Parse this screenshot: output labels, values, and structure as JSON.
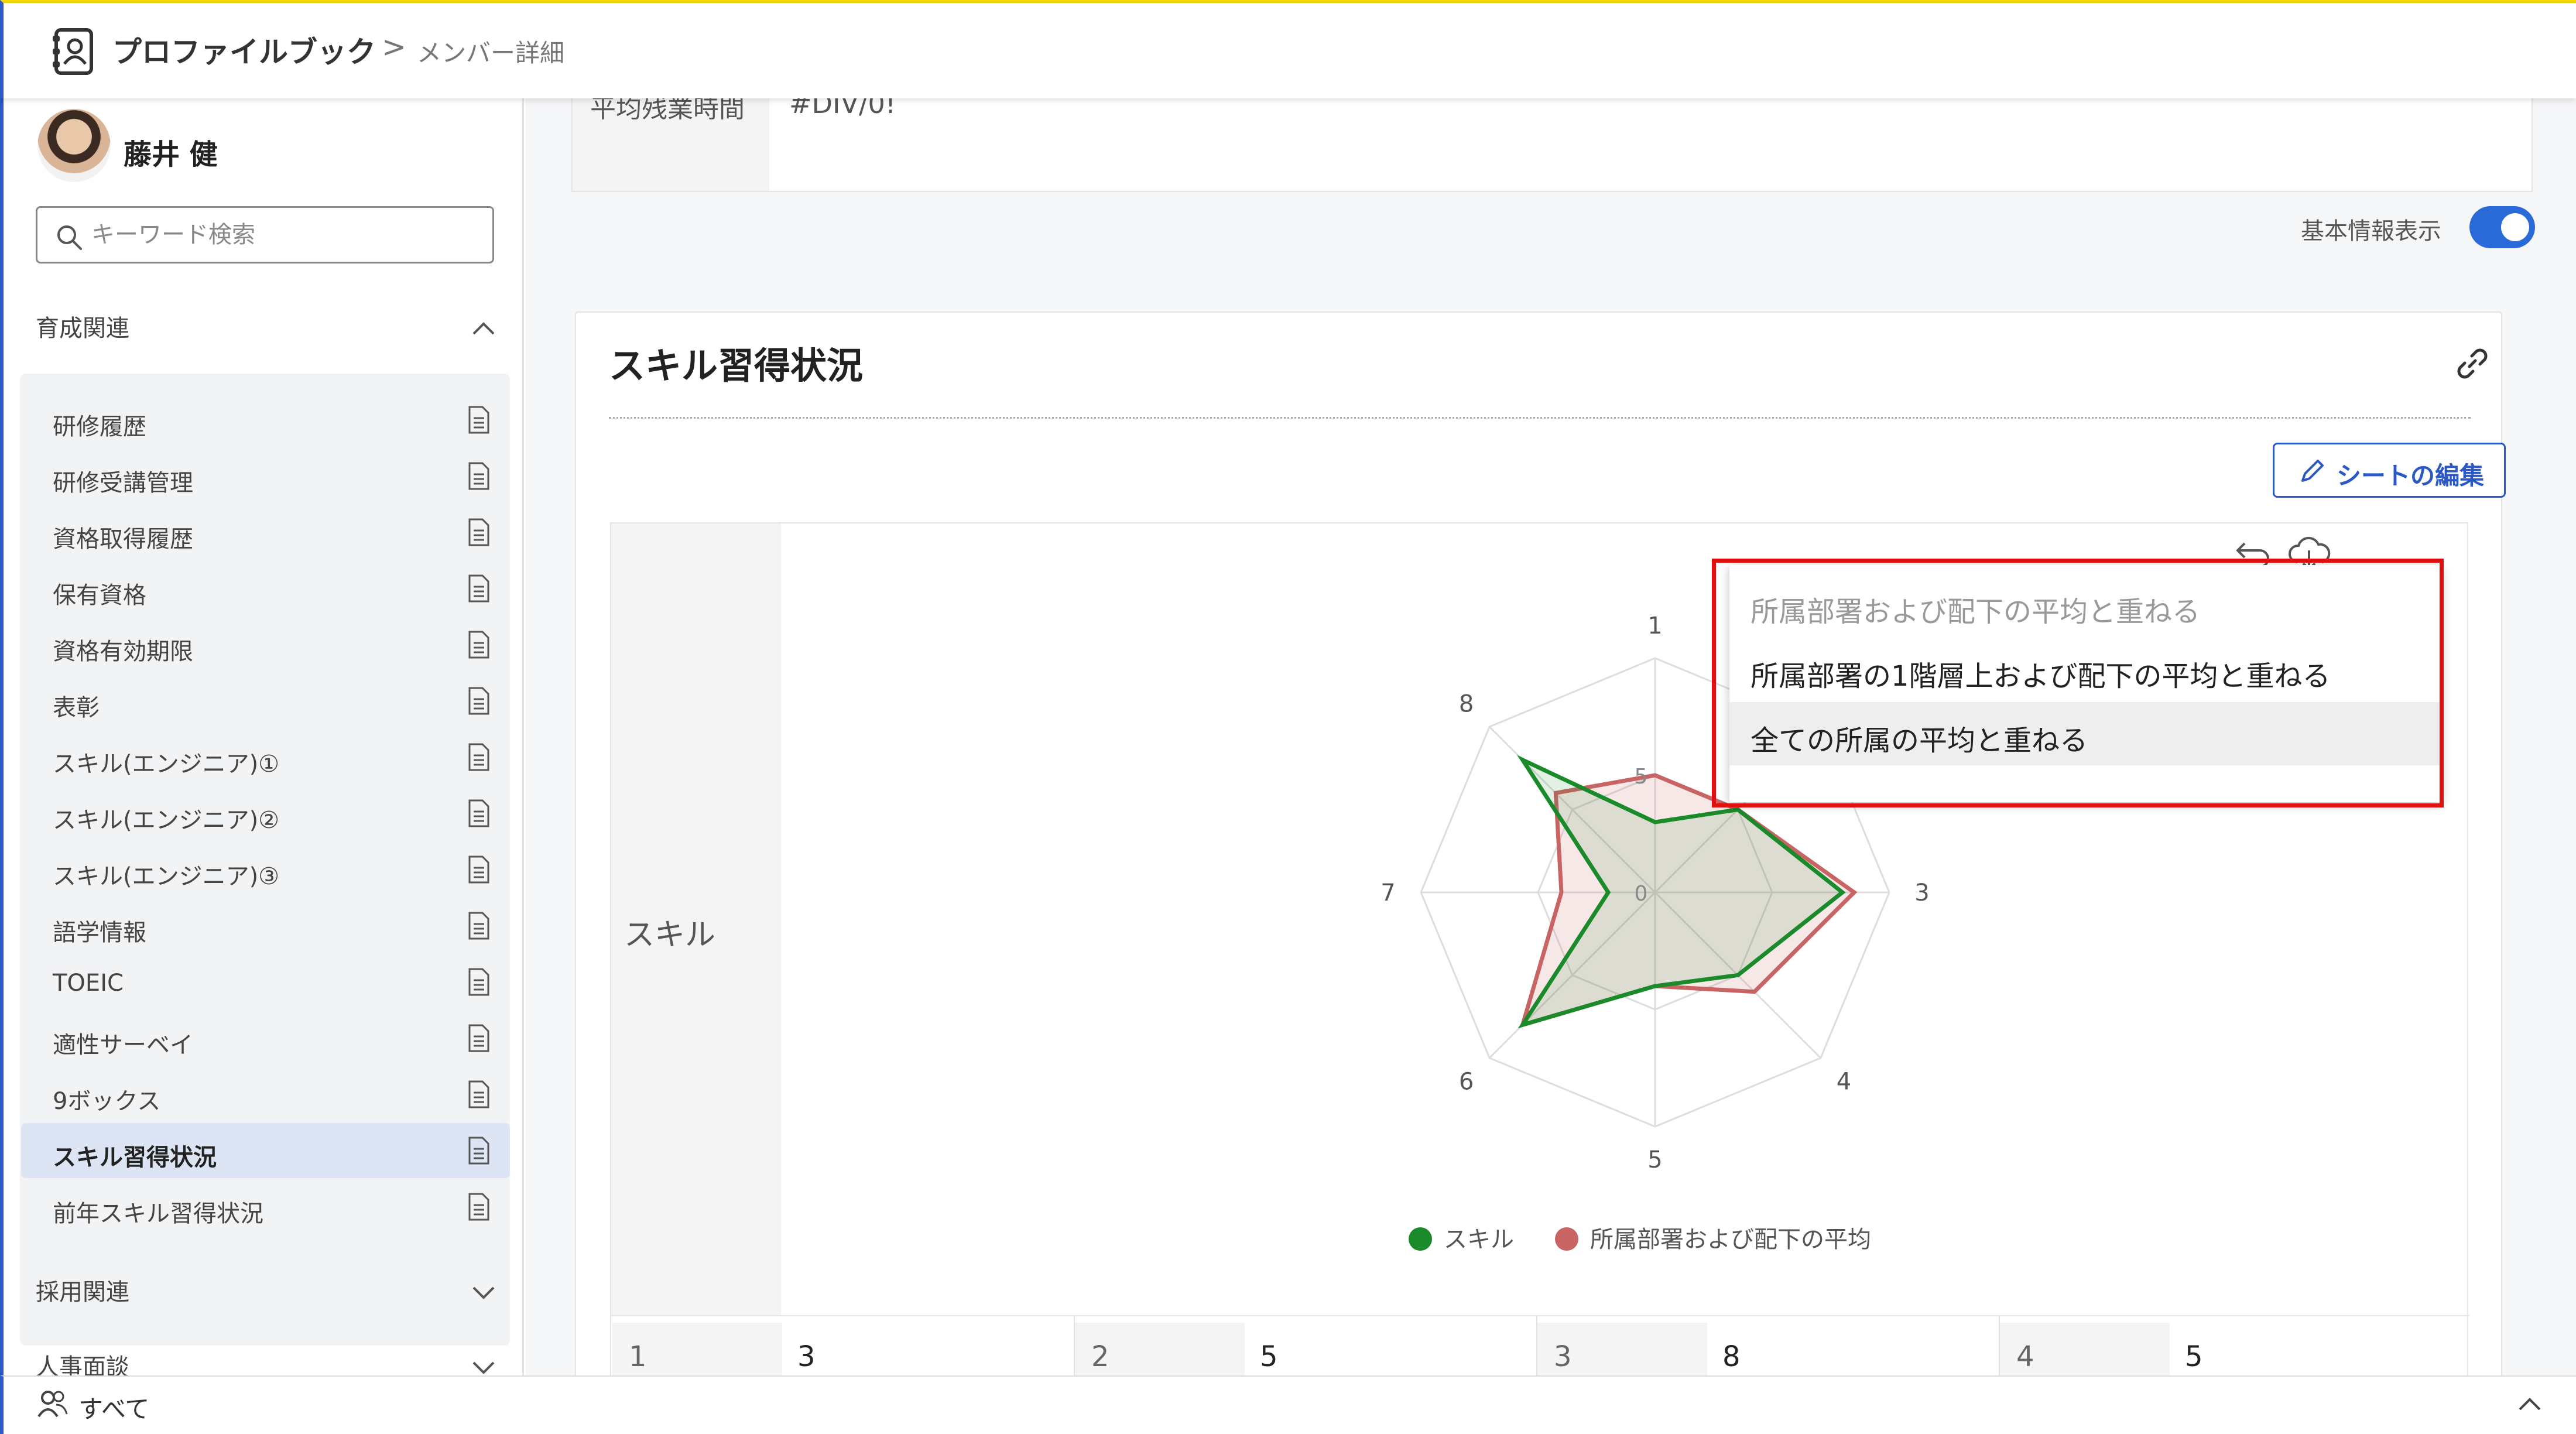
{
  "header": {
    "app_title": "プロファイルブック",
    "breadcrumb_sep": ">",
    "breadcrumb_current": "メンバー詳細"
  },
  "sidebar": {
    "user_name": "藤井 健",
    "search_placeholder": "キーワード検索",
    "section_ikusei": "育成関連",
    "items": [
      {
        "label": "研修履歴"
      },
      {
        "label": "研修受講管理"
      },
      {
        "label": "資格取得履歴"
      },
      {
        "label": "保有資格"
      },
      {
        "label": "資格有効期限"
      },
      {
        "label": "表彰"
      },
      {
        "label": "スキル(エンジニア)①"
      },
      {
        "label": "スキル(エンジニア)②"
      },
      {
        "label": "スキル(エンジニア)③"
      },
      {
        "label": "語学情報"
      },
      {
        "label": "TOEIC"
      },
      {
        "label": "適性サーベイ"
      },
      {
        "label": "9ボックス"
      },
      {
        "label": "スキル習得状況"
      },
      {
        "label": "前年スキル習得状況"
      }
    ],
    "active_item": "スキル習得状況",
    "section_saiyou": "採用関連",
    "section_jinji": "人事面談"
  },
  "footer": {
    "label": "すべて"
  },
  "info": {
    "label": "平均残業時間",
    "value": "#DIV/0!",
    "toggle_label": "基本情報表示",
    "toggle_on": true
  },
  "skill_card": {
    "title": "スキル習得状況",
    "edit_button": "シートの編集",
    "row_label": "スキル",
    "scores": [
      {
        "label": "1",
        "value": "3"
      },
      {
        "label": "2",
        "value": "5"
      },
      {
        "label": "3",
        "value": "8"
      },
      {
        "label": "4",
        "value": "5"
      }
    ]
  },
  "chart_data": {
    "type": "radar",
    "categories": [
      "1",
      "2",
      "3",
      "4",
      "5",
      "6",
      "7",
      "8"
    ],
    "scale_labels": [
      "0",
      "5"
    ],
    "rmax": 10,
    "series": [
      {
        "name": "スキル",
        "color": "#1a8a2a",
        "values": [
          3,
          5,
          8,
          5,
          4,
          8,
          2,
          8
        ]
      },
      {
        "name": "所属部署および配下の平均",
        "color": "#c86464",
        "values": [
          5,
          5,
          8.5,
          6,
          4,
          8,
          4,
          6
        ]
      }
    ],
    "legend_position": "bottom"
  },
  "dropdown": {
    "items": [
      {
        "label": "所属部署および配下の平均と重ねる",
        "state": "disabled"
      },
      {
        "label": "所属部署の1階層上および配下の平均と重ねる",
        "state": "normal"
      },
      {
        "label": "全ての所属の平均と重ねる",
        "state": "hover"
      }
    ]
  }
}
